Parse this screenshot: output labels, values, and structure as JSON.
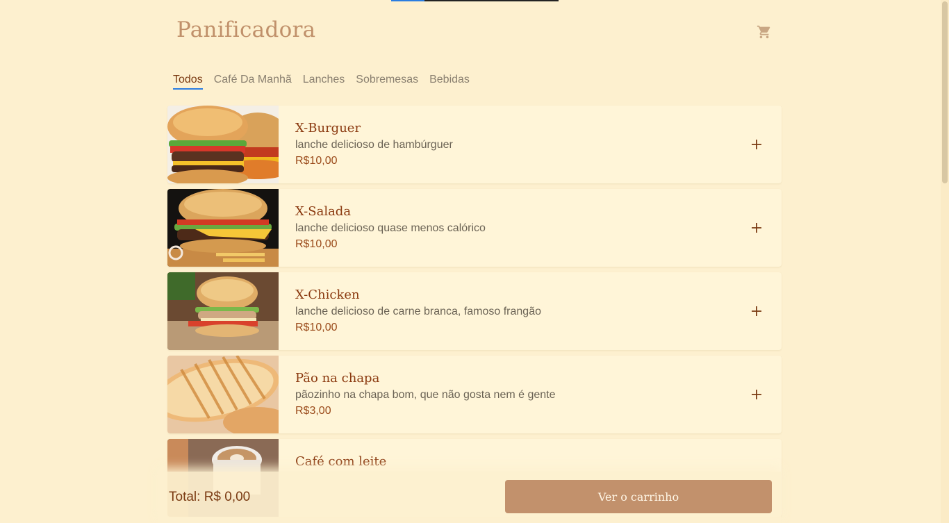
{
  "header": {
    "brand": "Panificadora",
    "cart_icon": "cart-icon"
  },
  "tabs": [
    {
      "label": "Todos",
      "active": true
    },
    {
      "label": "Café Da Manhã",
      "active": false
    },
    {
      "label": "Lanches",
      "active": false
    },
    {
      "label": "Sobremesas",
      "active": false
    },
    {
      "label": "Bebidas",
      "active": false
    }
  ],
  "products": [
    {
      "name": "X-Burguer",
      "description": "lanche delicioso de hambúrguer",
      "price": "R$10,00",
      "image": "burger-photo"
    },
    {
      "name": "X-Salada",
      "description": "lanche delicioso quase menos calórico",
      "price": "R$10,00",
      "image": "salad-burger-photo"
    },
    {
      "name": "X-Chicken",
      "description": "lanche delicioso de carne branca, famoso frangão",
      "price": "R$10,00",
      "image": "chicken-burger-photo"
    },
    {
      "name": "Pão na chapa",
      "description": "pãozinho na chapa bom, que não gosta nem é gente",
      "price": "R$3,00",
      "image": "toast-photo"
    },
    {
      "name": "Café com leite",
      "description": "",
      "price": "",
      "image": "coffee-photo"
    }
  ],
  "footer": {
    "total": "Total: R$ 0,00",
    "checkout_label": "Ver o carrinho"
  },
  "colors": {
    "background": "#fdf0cf",
    "card": "#fff5d8",
    "accent": "#c2916c",
    "title": "#8b3a10",
    "tab_indicator": "#2a7de1"
  }
}
